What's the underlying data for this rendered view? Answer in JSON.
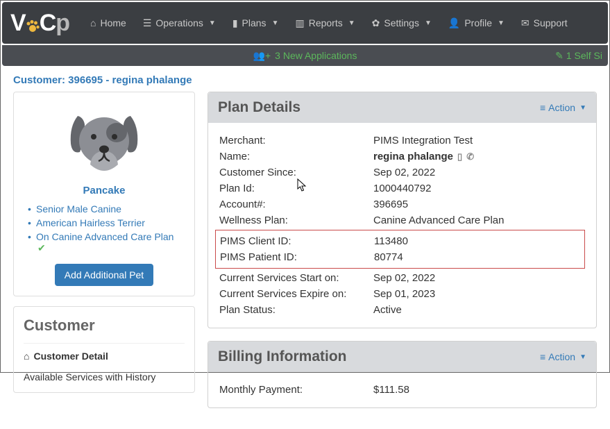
{
  "nav": {
    "home": "Home",
    "operations": "Operations",
    "plans": "Plans",
    "reports": "Reports",
    "settings": "Settings",
    "profile": "Profile",
    "support": "Support"
  },
  "status": {
    "new_apps": "3 New Applications",
    "self_signup": "1 Self Si"
  },
  "breadcrumb": "Customer: 396695 - regina phalange",
  "pet": {
    "name": "Pancake",
    "line1": "Senior Male Canine",
    "line2": "American Hairless Terrier",
    "line3": "On Canine Advanced Care Plan",
    "add_btn": "Add Additional Pet"
  },
  "customer": {
    "heading": "Customer",
    "detail_head": "Customer Detail",
    "sub1": "Available Services with History"
  },
  "plan": {
    "heading": "Plan Details",
    "action": "Action",
    "rows": {
      "merchant_l": "Merchant:",
      "merchant_v": "PIMS Integration Test",
      "name_l": "Name:",
      "name_v": "regina phalange",
      "since_l": "Customer Since:",
      "since_v": "Sep 02, 2022",
      "planid_l": "Plan Id:",
      "planid_v": "1000440792",
      "account_l": "Account#:",
      "account_v": "396695",
      "wellness_l": "Wellness Plan:",
      "wellness_v": "Canine Advanced Care Plan",
      "pims_client_l": "PIMS Client ID:",
      "pims_client_v": "113480",
      "pims_patient_l": "PIMS Patient ID:",
      "pims_patient_v": "80774",
      "start_l": "Current Services Start on:",
      "start_v": "Sep 02, 2022",
      "expire_l": "Current Services Expire on:",
      "expire_v": "Sep 01, 2023",
      "status_l": "Plan Status:",
      "status_v": "Active"
    }
  },
  "billing": {
    "heading": "Billing Information",
    "action": "Action",
    "monthly_l": "Monthly Payment:",
    "monthly_v": "$111.58"
  }
}
